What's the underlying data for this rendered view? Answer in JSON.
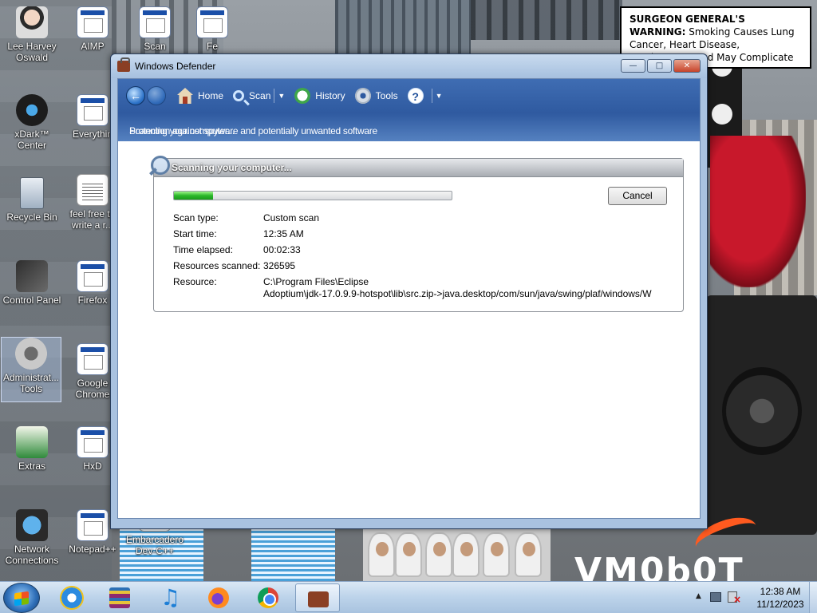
{
  "desktop": {
    "icons": [
      {
        "label": "Lee Harvey Oswald",
        "icon": "person-icon"
      },
      {
        "label": "AIMP",
        "icon": "aimp-icon"
      },
      {
        "label": "Scan",
        "icon": "gear-icon"
      },
      {
        "label": "Fe",
        "icon": "exe-icon"
      },
      {
        "label": "xDark™ Center",
        "icon": "xdark-icon"
      },
      {
        "label": "Everythin",
        "icon": "everything-icon"
      },
      {
        "label": "Recycle Bin",
        "icon": "recycle-bin-icon"
      },
      {
        "label": "feel free to write a r...",
        "icon": "document-icon"
      },
      {
        "label": "Control Panel",
        "icon": "control-panel-icon"
      },
      {
        "label": "Firefox",
        "icon": "firefox-icon"
      },
      {
        "label": "Administrat... Tools",
        "icon": "admin-tools-icon"
      },
      {
        "label": "Google Chrome",
        "icon": "chrome-icon"
      },
      {
        "label": "Extras",
        "icon": "extras-icon"
      },
      {
        "label": "HxD",
        "icon": "hxd-icon"
      },
      {
        "label": "Network Connections",
        "icon": "network-icon"
      },
      {
        "label": "Notepad++",
        "icon": "notepadpp-icon"
      },
      {
        "label": "Embarcadero Dev-C++",
        "icon": "devcpp-icon"
      }
    ],
    "warning": {
      "heading": "SURGEON GENERAL'S WARNING:",
      "body": " Smoking Causes Lung Cancer, Heart Disease, Emphysema, And May Complicate Pregnancy."
    },
    "brand_text": "VM0b0T"
  },
  "window": {
    "title": "Windows Defender",
    "controls": {
      "minimize": "—",
      "maximize": "□",
      "close": "✕"
    },
    "toolbar": {
      "back_icon": "back-arrow-icon",
      "forward_icon": "forward-arrow-icon",
      "home_label": "Home",
      "scan_label": "Scan",
      "history_label": "History",
      "tools_label": "Tools",
      "help_glyph": "?"
    },
    "status_overlay": [
      "Protection against spyware and potentially unwanted software",
      "Scanning your computer..."
    ],
    "scan": {
      "header": "Scanning your computer...",
      "progress_percent": 14,
      "cancel_label": "Cancel",
      "details": [
        {
          "label": "Scan type:",
          "value": "Custom scan"
        },
        {
          "label": "Start time:",
          "value": "12:35 AM"
        },
        {
          "label": "Time elapsed:",
          "value": "00:02:33"
        },
        {
          "label": "Resources scanned:",
          "value": "326595"
        }
      ],
      "resource_label": "Resource:",
      "resource_line1": "C:\\Program Files\\Eclipse",
      "resource_line2": "Adoptium\\jdk-17.0.9.9-hotspot\\lib\\src.zip->java.desktop/com/sun/java/swing/plaf/windows/W"
    }
  },
  "taskbar": {
    "apps": [
      {
        "name": "Internet Explorer",
        "icon": "ie-icon"
      },
      {
        "name": "WinRAR",
        "icon": "winrar-icon"
      },
      {
        "name": "Music",
        "icon": "music-icon"
      },
      {
        "name": "Firefox",
        "icon": "firefox-icon"
      },
      {
        "name": "Google Chrome",
        "icon": "chrome-icon"
      },
      {
        "name": "Windows Defender",
        "icon": "defender-icon"
      }
    ],
    "tray_arrow": "▲",
    "clock_time": "12:38 AM",
    "clock_date": "11/12/2023"
  },
  "colors": {
    "titlebar": "#a6c0df",
    "toolbar": "#2f5aa0",
    "progress": "#2bb82a",
    "close_button": "#c7432a"
  }
}
